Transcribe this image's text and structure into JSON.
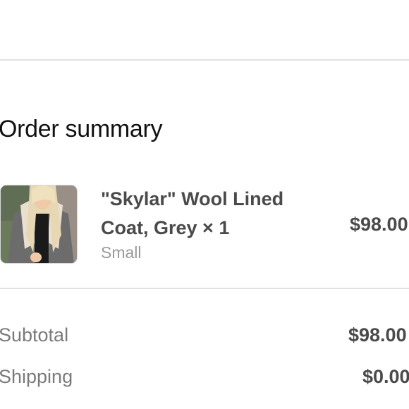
{
  "order_summary": {
    "title": "Order summary",
    "item": {
      "name": "\"Skylar\" Wool Lined Coat, Grey × 1",
      "variant": "Small",
      "price": "$98.00",
      "thumbnail_icon": "product-photo"
    },
    "subtotal": {
      "label": "Subtotal",
      "value": "$98.00"
    },
    "shipping": {
      "label": "Shipping",
      "value": "$0.00"
    }
  }
}
